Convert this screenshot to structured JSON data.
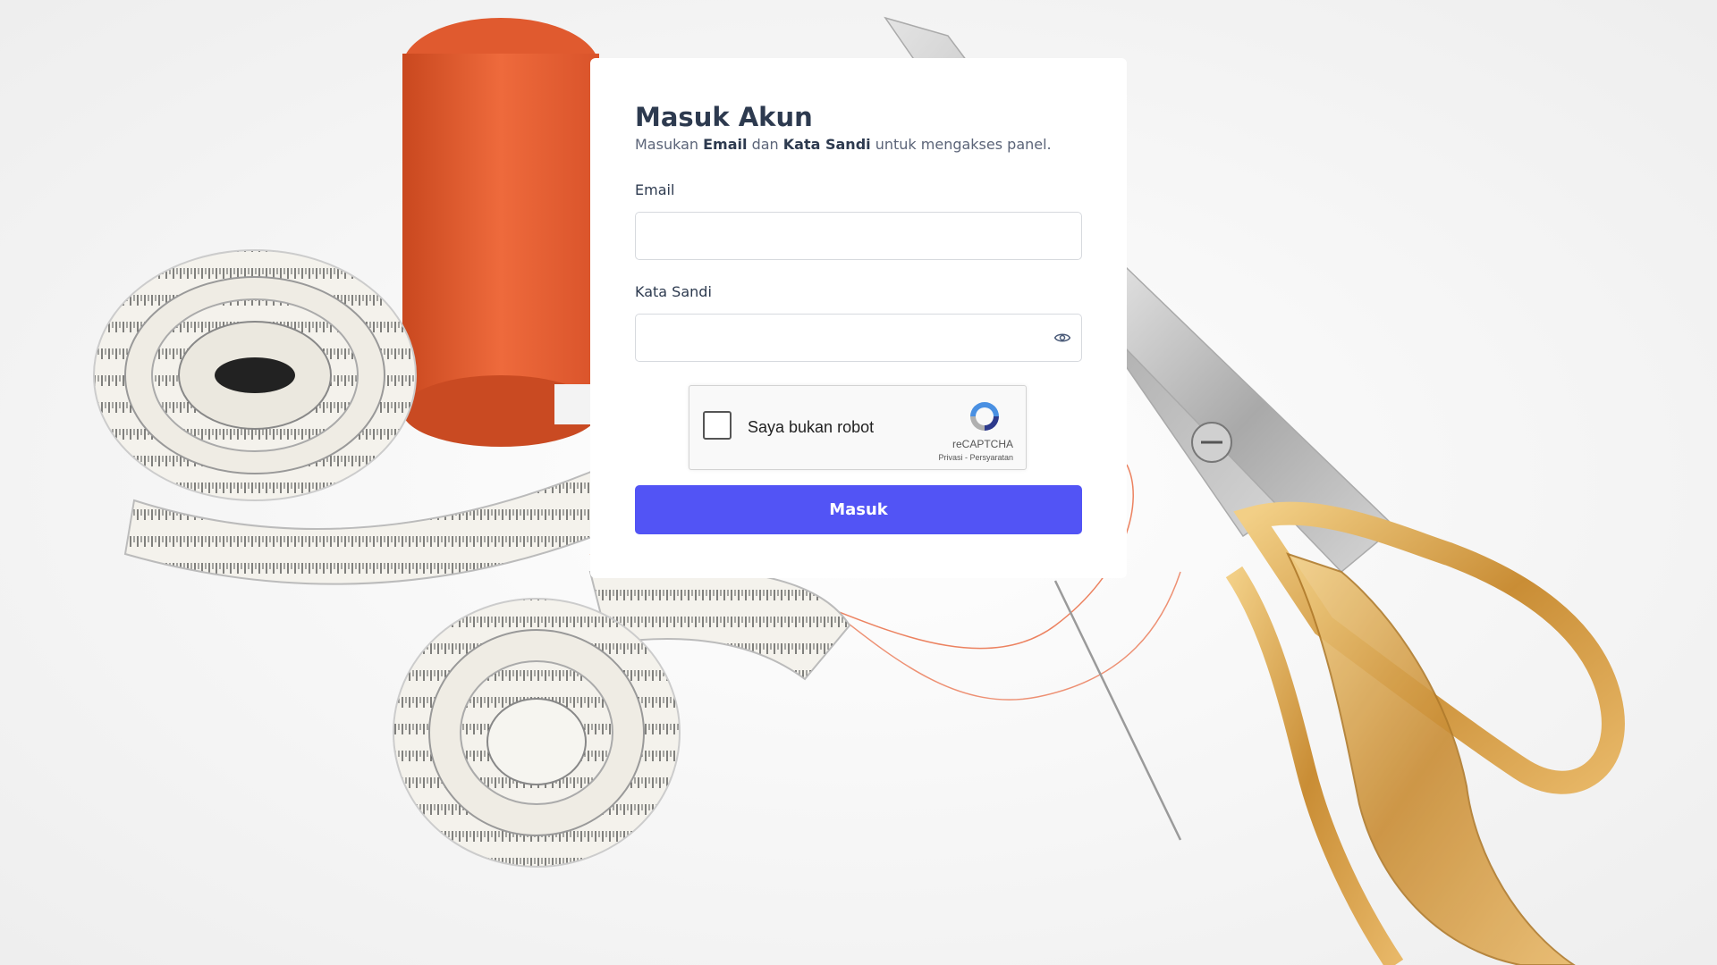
{
  "login": {
    "title": "Masuk Akun",
    "subtitle_prefix": "Masukan ",
    "subtitle_email": "Email",
    "subtitle_and": " dan ",
    "subtitle_password": "Kata Sandi",
    "subtitle_suffix": " untuk mengakses panel.",
    "email_label": "Email",
    "email_value": "",
    "password_label": "Kata Sandi",
    "password_value": "",
    "submit_label": "Masuk"
  },
  "captcha": {
    "label": "Saya bukan robot",
    "brand": "reCAPTCHA",
    "links": "Privasi - Persyaratan",
    "checked": false
  },
  "icons": {
    "show_password": "eye-icon",
    "captcha_logo": "recaptcha-logo-icon"
  },
  "colors": {
    "primary": "#5254f5",
    "title": "#2d3a4f",
    "thread": "#e8643a",
    "tape": "#f3f1ea",
    "scissors_gold": "#d9a44a"
  }
}
